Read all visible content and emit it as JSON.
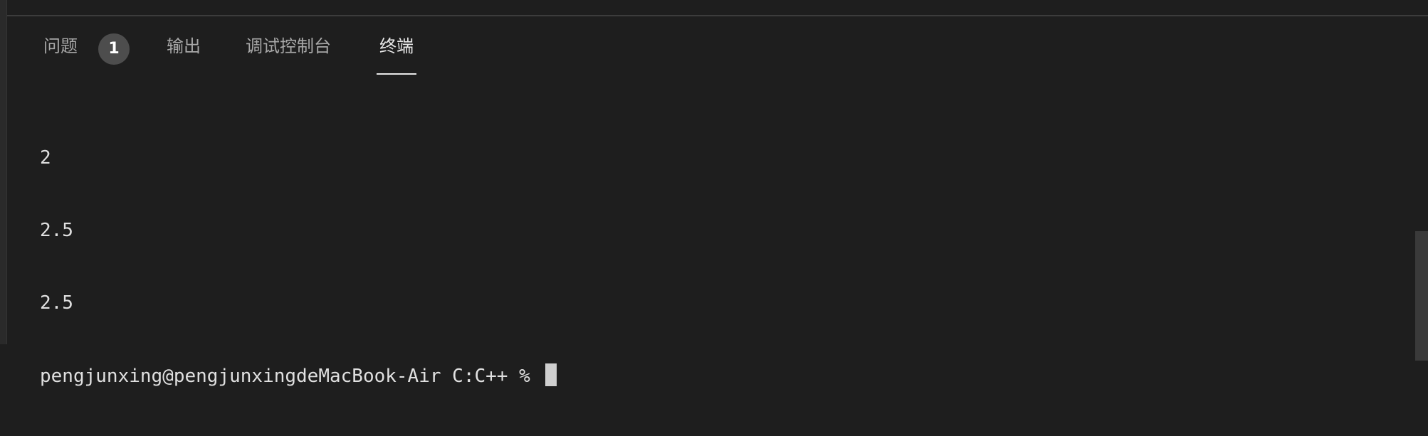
{
  "panel": {
    "tabs": [
      {
        "label": "问题",
        "badge": "1",
        "active": false
      },
      {
        "label": "输出",
        "active": false
      },
      {
        "label": "调试控制台",
        "active": false
      },
      {
        "label": "终端",
        "active": true
      }
    ]
  },
  "terminal": {
    "lines": [
      "2",
      "2.5",
      "2.5"
    ],
    "prompt": "pengjunxing@pengjunxingdeMacBook-Air C:C++ % "
  },
  "colors": {
    "background": "#1e1e1e",
    "active_tab": "#e8e8e8",
    "inactive_tab": "#a8a8a8",
    "badge": "#4d4d4d"
  }
}
